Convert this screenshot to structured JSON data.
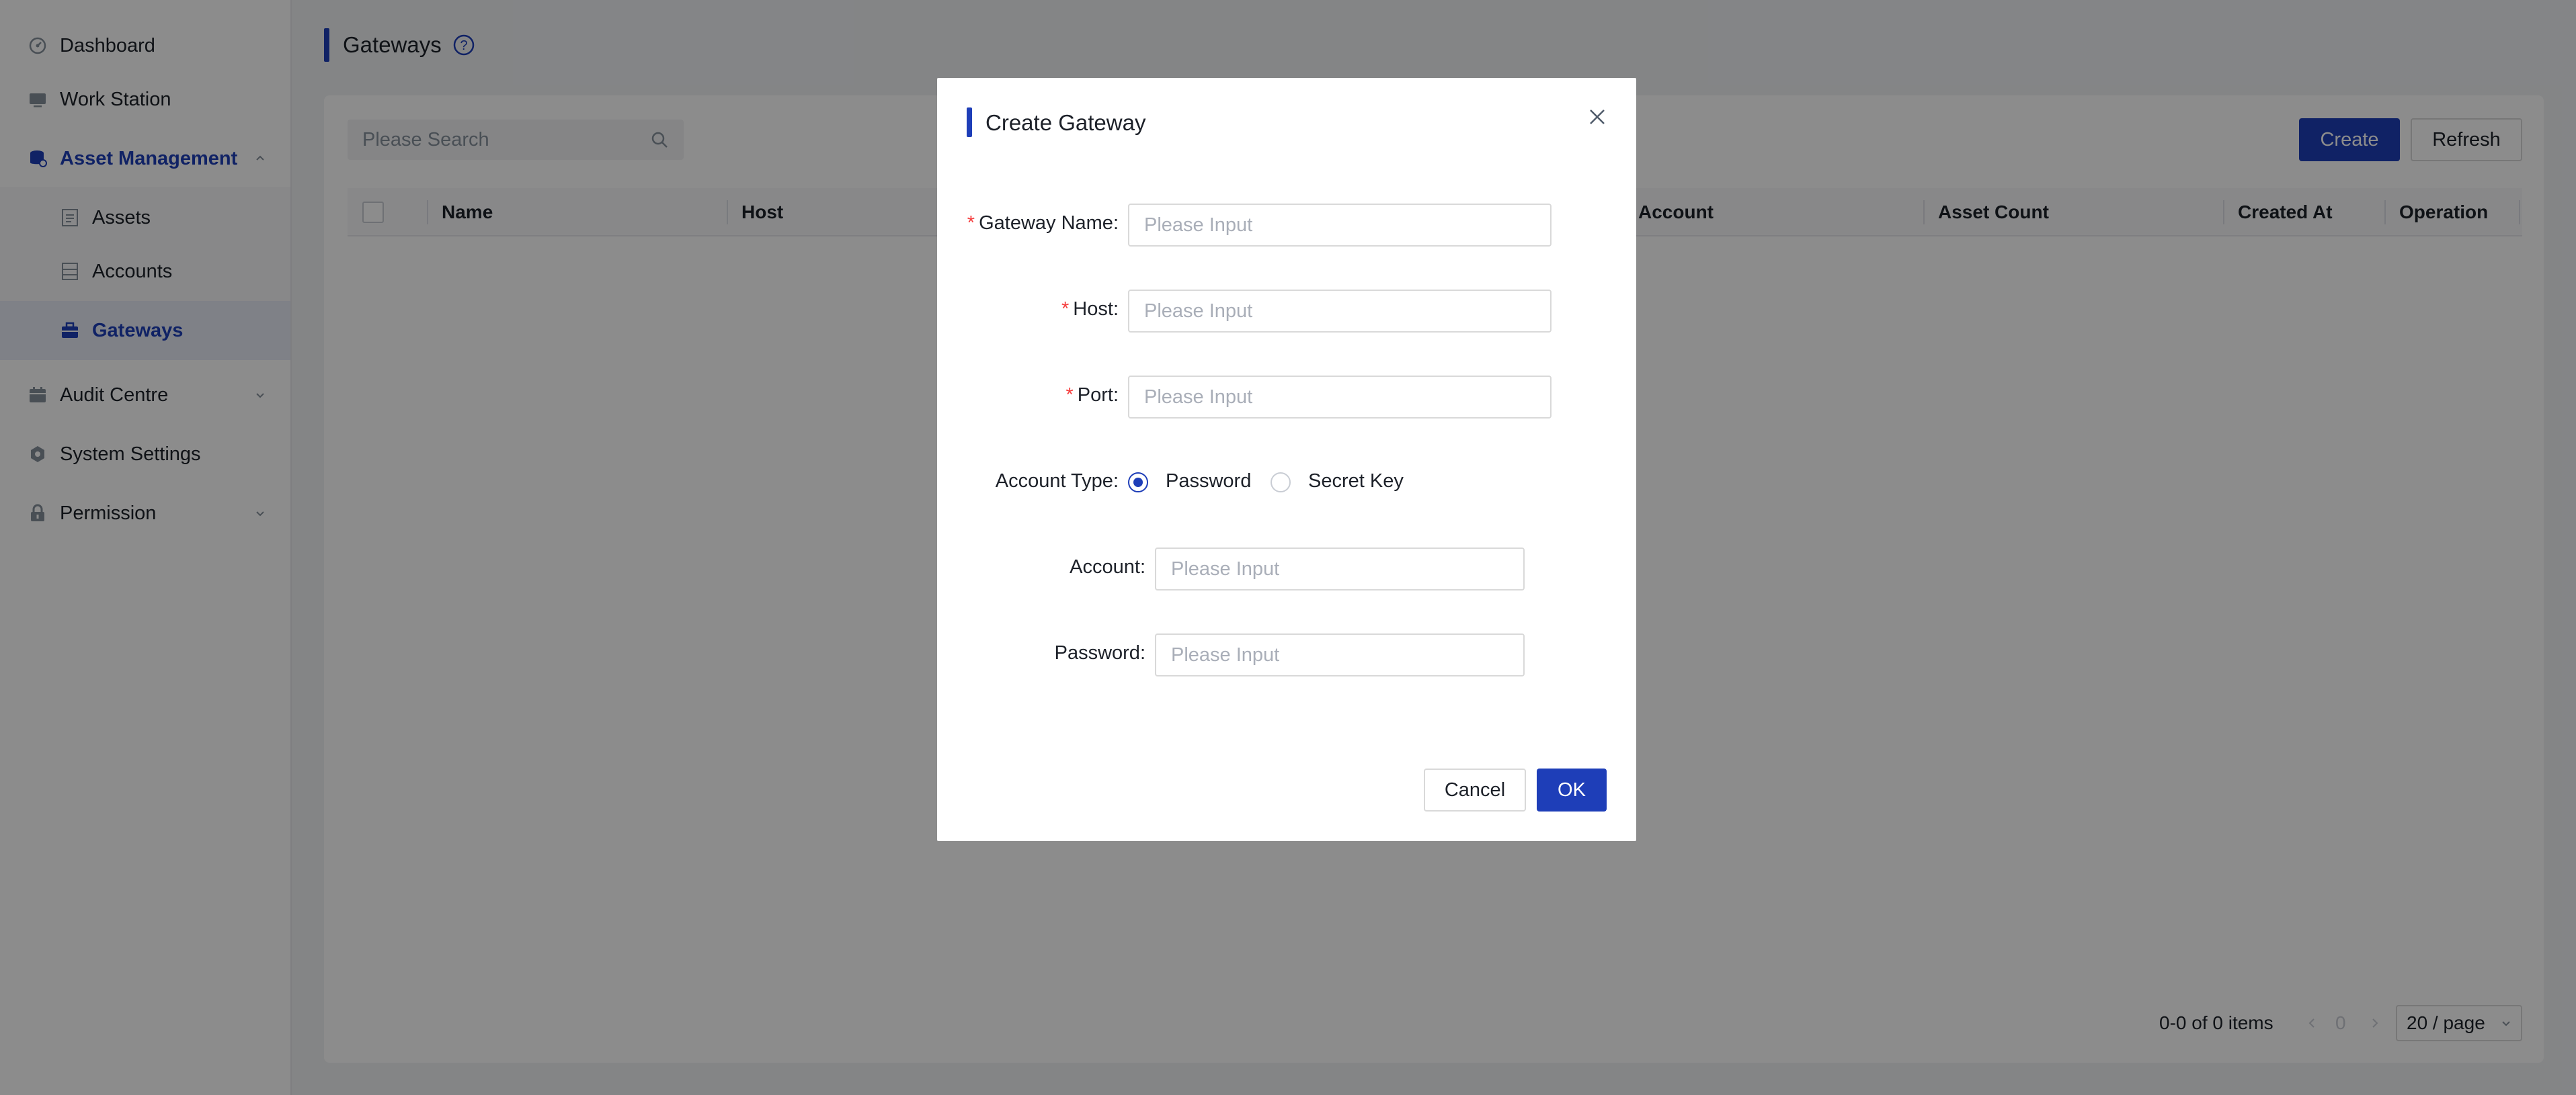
{
  "sidebar": {
    "items": [
      {
        "label": "Dashboard",
        "icon": "dashboard-icon"
      },
      {
        "label": "Work Station",
        "icon": "monitor-icon"
      },
      {
        "label": "Asset Management",
        "icon": "database-icon",
        "expanded": true
      },
      {
        "label": "Assets",
        "icon": "document-icon"
      },
      {
        "label": "Accounts",
        "icon": "list-icon"
      },
      {
        "label": "Gateways",
        "icon": "briefcase-icon",
        "active": true
      },
      {
        "label": "Audit Centre",
        "icon": "calendar-icon"
      },
      {
        "label": "System Settings",
        "icon": "gear-icon"
      },
      {
        "label": "Permission",
        "icon": "lock-icon"
      }
    ]
  },
  "page": {
    "title": "Gateways",
    "search_placeholder": "Please Search",
    "create_label": "Create",
    "refresh_label": "Refresh"
  },
  "table": {
    "columns": [
      "Name",
      "Host",
      "Account",
      "Asset Count",
      "Created At",
      "Operation"
    ],
    "rows": []
  },
  "pagination": {
    "summary": "0-0 of 0 items",
    "current_page": "0",
    "page_size": "20 / page"
  },
  "modal": {
    "title": "Create Gateway",
    "fields": {
      "gateway_name": {
        "label": "Gateway Name",
        "placeholder": "Please Input",
        "required": true
      },
      "host": {
        "label": "Host",
        "placeholder": "Please Input",
        "required": true
      },
      "port": {
        "label": "Port",
        "placeholder": "Please Input",
        "required": true
      },
      "account_type": {
        "label": "Account Type",
        "options": [
          "Password",
          "Secret Key"
        ],
        "selected": "Password"
      },
      "account": {
        "label": "Account",
        "placeholder": "Please Input"
      },
      "password": {
        "label": "Password",
        "placeholder": "Please Input"
      }
    },
    "colon": ":",
    "cancel_label": "Cancel",
    "ok_label": "OK"
  },
  "colors": {
    "primary": "#1e3eb8",
    "required": "#f53f3f"
  }
}
